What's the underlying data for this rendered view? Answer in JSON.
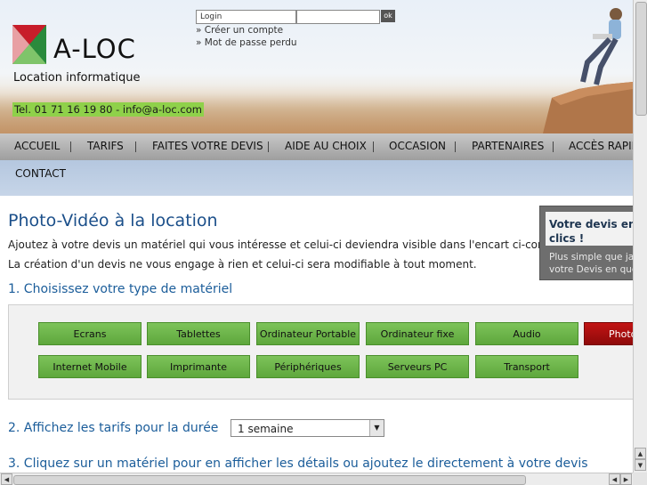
{
  "header": {
    "logo_text": "A-LOC",
    "logo_subtitle": "Location informatique",
    "contact": "Tel. 01 71 16 19 80 - info@a-loc.com",
    "login_placeholder": "Login",
    "password_value": "",
    "ok_label": "ok",
    "create_account": "» Créer un compte",
    "forgot_password": "» Mot de passe perdu"
  },
  "nav": {
    "items": [
      "ACCUEIL",
      "TARIFS",
      "FAITES VOTRE DEVIS",
      "AIDE AU CHOIX",
      "OCCASION",
      "PARTENAIRES",
      "ACCÈS RAPIDE"
    ],
    "second_row": [
      "CONTACT"
    ]
  },
  "main": {
    "title": "Photo-Vidéo à la location",
    "intro_1": "Ajoutez à votre devis un matériel qui vous intéresse et celui-ci deviendra visible dans l'encart ci-contre.",
    "intro_2": "La création d'un devis ne vous engage à rien et celui-ci sera modifiable à tout moment.",
    "step1_title": "1. Choisissez votre type de matériel",
    "types_row1": [
      "Ecrans",
      "Tablettes",
      "Ordinateur Portable",
      "Ordinateur fixe",
      "Audio",
      "Photo"
    ],
    "types_row2": [
      "Internet Mobile",
      "Imprimante",
      "Périphériques",
      "Serveurs PC",
      "Transport"
    ],
    "active_type": "Photo",
    "step2_title": "2. Affichez les tarifs pour la durée",
    "duration_value": "1 semaine",
    "step3_title": "3. Cliquez sur un matériel pour en afficher les détails ou ajoutez le directement à votre devis"
  },
  "side": {
    "devis_title_1": "Votre devis en",
    "devis_title_2": "clics !",
    "devis_text_1": "Plus simple que ja",
    "devis_text_2": "votre Devis en que"
  },
  "colors": {
    "accent_blue": "#1b4f8a",
    "type_button_green": "#6cb54a",
    "type_button_active": "#b01010",
    "contact_bar": "#8fd14a"
  }
}
